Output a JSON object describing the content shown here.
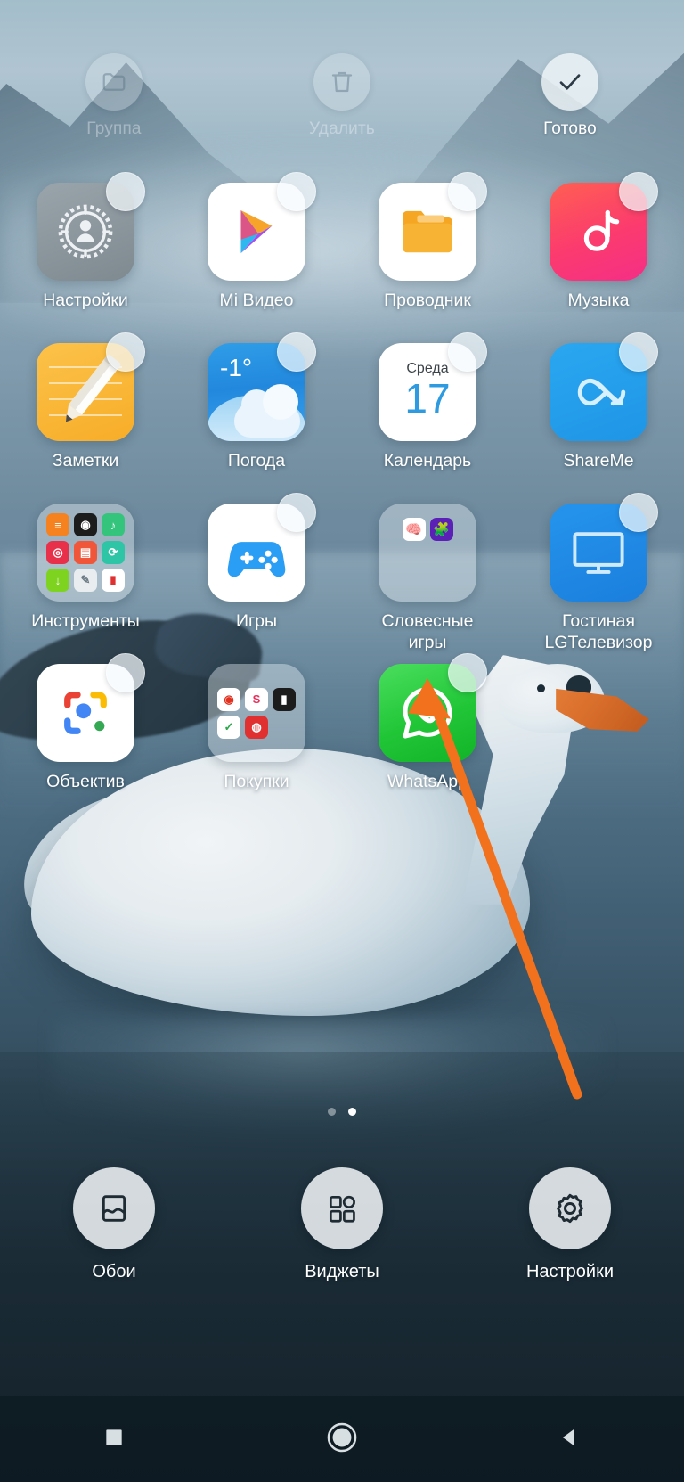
{
  "screen": {
    "mode": "home-screen-edit-mode",
    "locale": "ru"
  },
  "top_toolbar": {
    "buttons": [
      {
        "label": "Группа",
        "icon": "folder-icon",
        "enabled": false
      },
      {
        "label": "Удалить",
        "icon": "trash-icon",
        "enabled": false
      },
      {
        "label": "Готово",
        "icon": "checkmark-icon",
        "enabled": true
      }
    ]
  },
  "app_grid": {
    "rows": [
      {
        "apps": [
          {
            "label": "Настройки",
            "icon": "settings-gear-icon",
            "selected": true,
            "type": "app"
          },
          {
            "label": "Mi Видео",
            "icon": "mi-video-icon",
            "selected": true,
            "type": "app"
          },
          {
            "label": "Проводник",
            "icon": "file-manager-icon",
            "selected": true,
            "type": "app"
          },
          {
            "label": "Музыка",
            "icon": "music-note-icon",
            "selected": true,
            "type": "app"
          }
        ]
      },
      {
        "apps": [
          {
            "label": "Заметки",
            "icon": "notes-pencil-icon",
            "selected": true,
            "type": "app"
          },
          {
            "label": "Погода",
            "icon": "weather-icon",
            "selected": true,
            "type": "app",
            "temperature": "-1°"
          },
          {
            "label": "Календарь",
            "icon": "calendar-icon",
            "selected": true,
            "type": "app",
            "weekday": "Среда",
            "day": "17"
          },
          {
            "label": "ShareMe",
            "icon": "shareme-icon",
            "selected": true,
            "type": "app"
          }
        ]
      },
      {
        "apps": [
          {
            "label": "Инструменты",
            "icon": "folder-tools-icon",
            "selected": false,
            "type": "folder",
            "item_count": 9
          },
          {
            "label": "Игры",
            "icon": "gamepad-icon",
            "selected": true,
            "type": "app"
          },
          {
            "label": "Словесные\nигры",
            "icon": "folder-word-games-icon",
            "selected": false,
            "type": "folder",
            "item_count": 2
          },
          {
            "label": "Гостиная\nLGТелевизор",
            "icon": "tv-icon",
            "selected": true,
            "type": "app"
          }
        ]
      },
      {
        "apps": [
          {
            "label": "Объектив",
            "icon": "google-lens-icon",
            "selected": true,
            "type": "app"
          },
          {
            "label": "Покупки",
            "icon": "folder-shopping-icon",
            "selected": false,
            "type": "folder",
            "item_count": 5
          },
          {
            "label": "WhatsApp",
            "icon": "whatsapp-icon",
            "selected": true,
            "type": "app"
          }
        ]
      }
    ]
  },
  "page_indicator": {
    "total": 2,
    "active_index": 1
  },
  "bottom_toolbar": {
    "buttons": [
      {
        "label": "Обои",
        "icon": "wallpaper-icon"
      },
      {
        "label": "Виджеты",
        "icon": "widgets-grid-icon"
      },
      {
        "label": "Настройки",
        "icon": "settings-gear-icon"
      }
    ]
  },
  "navigation_bar": {
    "buttons": [
      {
        "icon": "recents-square-icon"
      },
      {
        "icon": "home-circle-icon"
      },
      {
        "icon": "back-triangle-icon"
      }
    ]
  },
  "annotation": {
    "type": "arrow",
    "color": "#f2711c",
    "points_to": "whatsapp-selection-badge"
  },
  "colors": {
    "accent_orange": "#f2711c",
    "whatsapp_green": "#25d366",
    "calendar_blue": "#2e9be0",
    "notes_yellow": "#f7ad28"
  }
}
